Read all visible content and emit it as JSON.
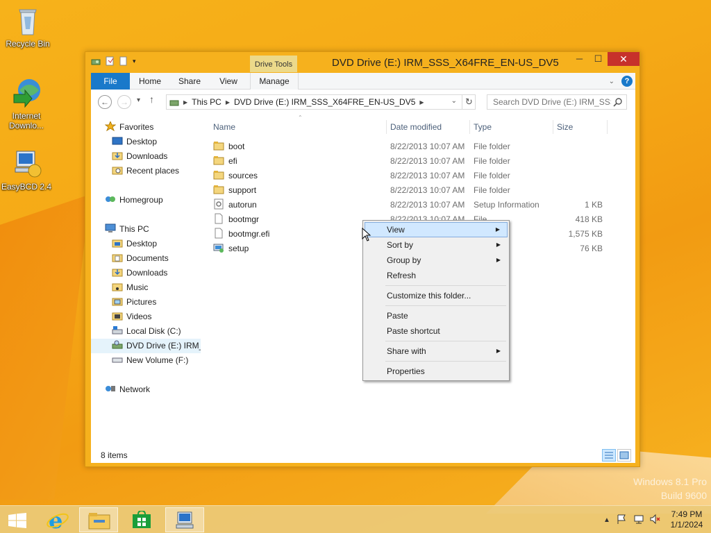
{
  "desktop": {
    "icons": [
      {
        "label": "Recycle Bin"
      },
      {
        "label": "Internet Downlo..."
      },
      {
        "label": "EasyBCD 2.4"
      }
    ],
    "watermark": [
      "Windows 8.1 Pro",
      "Build 9600"
    ]
  },
  "window": {
    "title": "DVD Drive (E:) IRM_SSS_X64FRE_EN-US_DV5",
    "contextual_tab": "Drive Tools",
    "controls": {
      "minimize": "─",
      "maximize": "☐",
      "close": "✕"
    },
    "ribbon_tabs": [
      "File",
      "Home",
      "Share",
      "View",
      "Manage"
    ],
    "address": {
      "crumbs": [
        "This PC",
        "DVD Drive (E:) IRM_SSS_X64FRE_EN-US_DV5"
      ]
    },
    "search": {
      "placeholder": "Search DVD Drive (E:) IRM_SSS..."
    },
    "nav": {
      "favorites": "Favorites",
      "favorites_items": [
        "Desktop",
        "Downloads",
        "Recent places"
      ],
      "homegroup": "Homegroup",
      "thispc": "This PC",
      "thispc_items": [
        "Desktop",
        "Documents",
        "Downloads",
        "Music",
        "Pictures",
        "Videos",
        "Local Disk (C:)",
        "DVD Drive (E:) IRM_SSS_X64FRE_EN-US_DV5",
        "New Volume (F:)"
      ],
      "network": "Network"
    },
    "columns": [
      "Name",
      "Date modified",
      "Type",
      "Size"
    ],
    "files": [
      {
        "name": "boot",
        "date": "8/22/2013 10:07 AM",
        "type": "File folder",
        "size": "",
        "icon": "folder-icon"
      },
      {
        "name": "efi",
        "date": "8/22/2013 10:07 AM",
        "type": "File folder",
        "size": "",
        "icon": "folder-icon"
      },
      {
        "name": "sources",
        "date": "8/22/2013 10:07 AM",
        "type": "File folder",
        "size": "",
        "icon": "folder-icon"
      },
      {
        "name": "support",
        "date": "8/22/2013 10:07 AM",
        "type": "File folder",
        "size": "",
        "icon": "folder-icon"
      },
      {
        "name": "autorun",
        "date": "8/22/2013 10:07 AM",
        "type": "Setup Information",
        "size": "1 KB",
        "icon": "setup-info-icon"
      },
      {
        "name": "bootmgr",
        "date": "8/22/2013 10:07 AM",
        "type": "File",
        "size": "418 KB",
        "icon": "file-icon"
      },
      {
        "name": "bootmgr.efi",
        "date": "",
        "type": "",
        "size": "1,575 KB",
        "icon": "file-icon"
      },
      {
        "name": "setup",
        "date": "",
        "type": "ation",
        "size": "76 KB",
        "icon": "setup-app-icon"
      }
    ],
    "status": "8 items"
  },
  "context_menu": {
    "items": [
      {
        "label": "View",
        "submenu": true,
        "highlighted": true
      },
      {
        "label": "Sort by",
        "submenu": true
      },
      {
        "label": "Group by",
        "submenu": true
      },
      {
        "label": "Refresh"
      },
      {
        "sep": true
      },
      {
        "label": "Customize this folder..."
      },
      {
        "sep": true
      },
      {
        "label": "Paste"
      },
      {
        "label": "Paste shortcut"
      },
      {
        "sep": true
      },
      {
        "label": "Share with",
        "submenu": true
      },
      {
        "sep": true
      },
      {
        "label": "Properties"
      }
    ]
  },
  "taskbar": {
    "time": "7:49 PM",
    "date": "1/1/2024"
  },
  "colors": {
    "accent": "#1979ca",
    "desktop": "#f5a916",
    "selection": "#d1e8ff"
  }
}
